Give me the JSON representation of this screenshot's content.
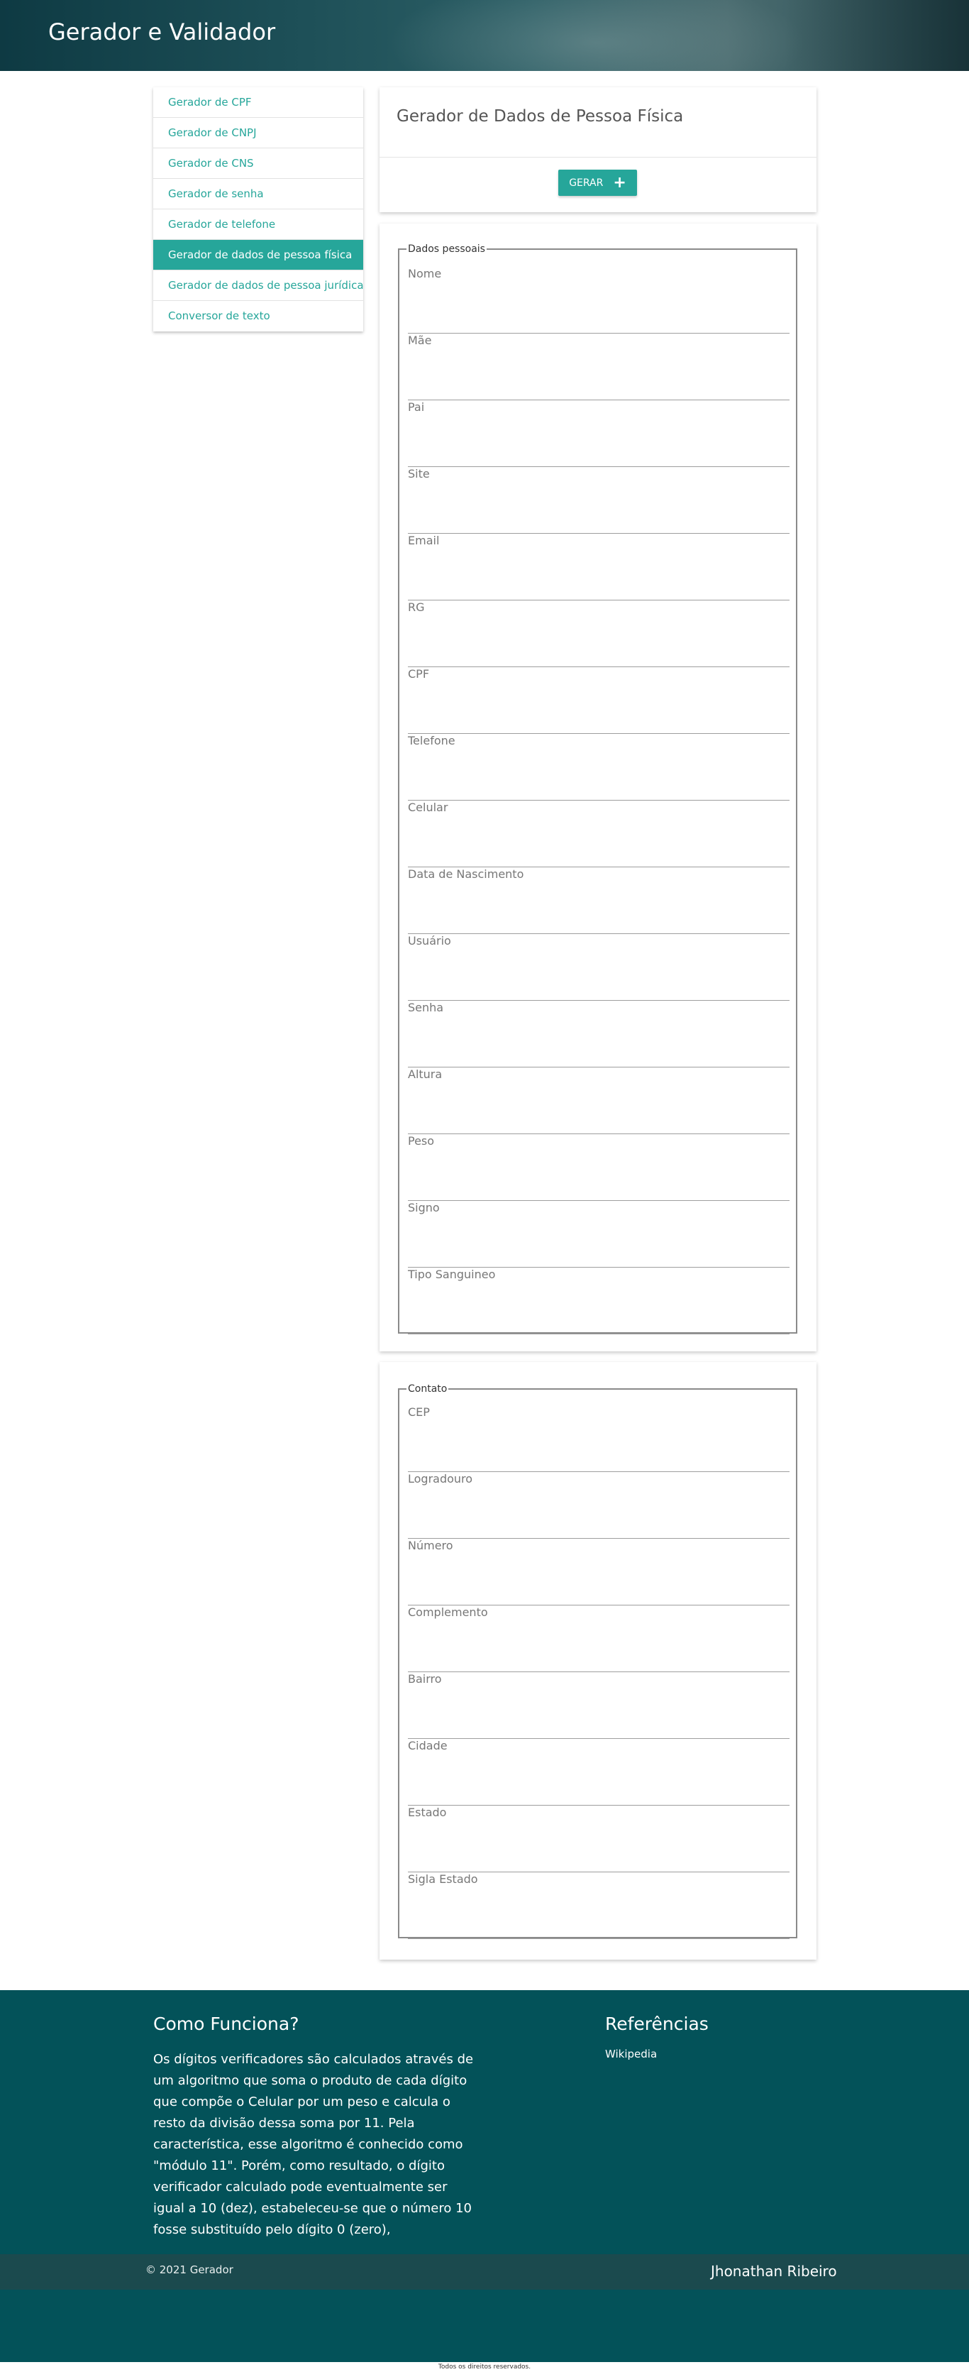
{
  "header": {
    "title": "Gerador e Validador"
  },
  "sidebar": {
    "items": [
      {
        "label": "Gerador de CPF"
      },
      {
        "label": "Gerador de CNPJ"
      },
      {
        "label": "Gerador de CNS"
      },
      {
        "label": "Gerador de senha"
      },
      {
        "label": "Gerador de telefone"
      },
      {
        "label": "Gerador de dados de pessoa física",
        "active": true
      },
      {
        "label": "Gerador de dados de pessoa jurídica"
      },
      {
        "label": "Conversor de texto"
      }
    ]
  },
  "main": {
    "title": "Gerador de Dados de Pessoa Física",
    "generate_button": "GERAR",
    "personal": {
      "legend": "Dados pessoais",
      "fields": [
        {
          "label": "Nome",
          "value": ""
        },
        {
          "label": "Mãe",
          "value": ""
        },
        {
          "label": "Pai",
          "value": ""
        },
        {
          "label": "Site",
          "value": ""
        },
        {
          "label": "Email",
          "value": ""
        },
        {
          "label": "RG",
          "value": ""
        },
        {
          "label": "CPF",
          "value": ""
        },
        {
          "label": "Telefone",
          "value": ""
        },
        {
          "label": "Celular",
          "value": ""
        },
        {
          "label": "Data de Nascimento",
          "value": ""
        },
        {
          "label": "Usuário",
          "value": ""
        },
        {
          "label": "Senha",
          "value": ""
        },
        {
          "label": "Altura",
          "value": ""
        },
        {
          "label": "Peso",
          "value": ""
        },
        {
          "label": "Signo",
          "value": ""
        },
        {
          "label": "Tipo Sanguineo",
          "value": ""
        }
      ]
    },
    "contact": {
      "legend": "Contato",
      "fields": [
        {
          "label": "CEP",
          "value": ""
        },
        {
          "label": "Logradouro",
          "value": ""
        },
        {
          "label": "Número",
          "value": ""
        },
        {
          "label": "Complemento",
          "value": ""
        },
        {
          "label": "Bairro",
          "value": ""
        },
        {
          "label": "Cidade",
          "value": ""
        },
        {
          "label": "Estado",
          "value": ""
        },
        {
          "label": "Sigla Estado",
          "value": ""
        }
      ]
    }
  },
  "footer": {
    "how_title": "Como Funciona?",
    "how_text": "Os dígitos verificadores são calculados através de um algoritmo que soma o produto de cada dígito que compõe o Celular por um peso e calcula o resto da divisão dessa soma por 11. Pela característica, esse algoritmo é conhecido como \"módulo 11\". Porém, como resultado, o dígito verificador calculado pode eventualmente ser igual a 10 (dez), estabeleceu-se que o número 10 fosse substituído pelo dígito 0 (zero),",
    "ref_title": "Referências",
    "ref_link": "Wikipedia",
    "copyright": "© 2021 Gerador",
    "author": "Jhonathan Ribeiro",
    "rights": "Todos os direitos reservados."
  },
  "colors": {
    "accent": "#26a69a",
    "footer": "#035259",
    "footer_bar": "#1b4a4e"
  }
}
